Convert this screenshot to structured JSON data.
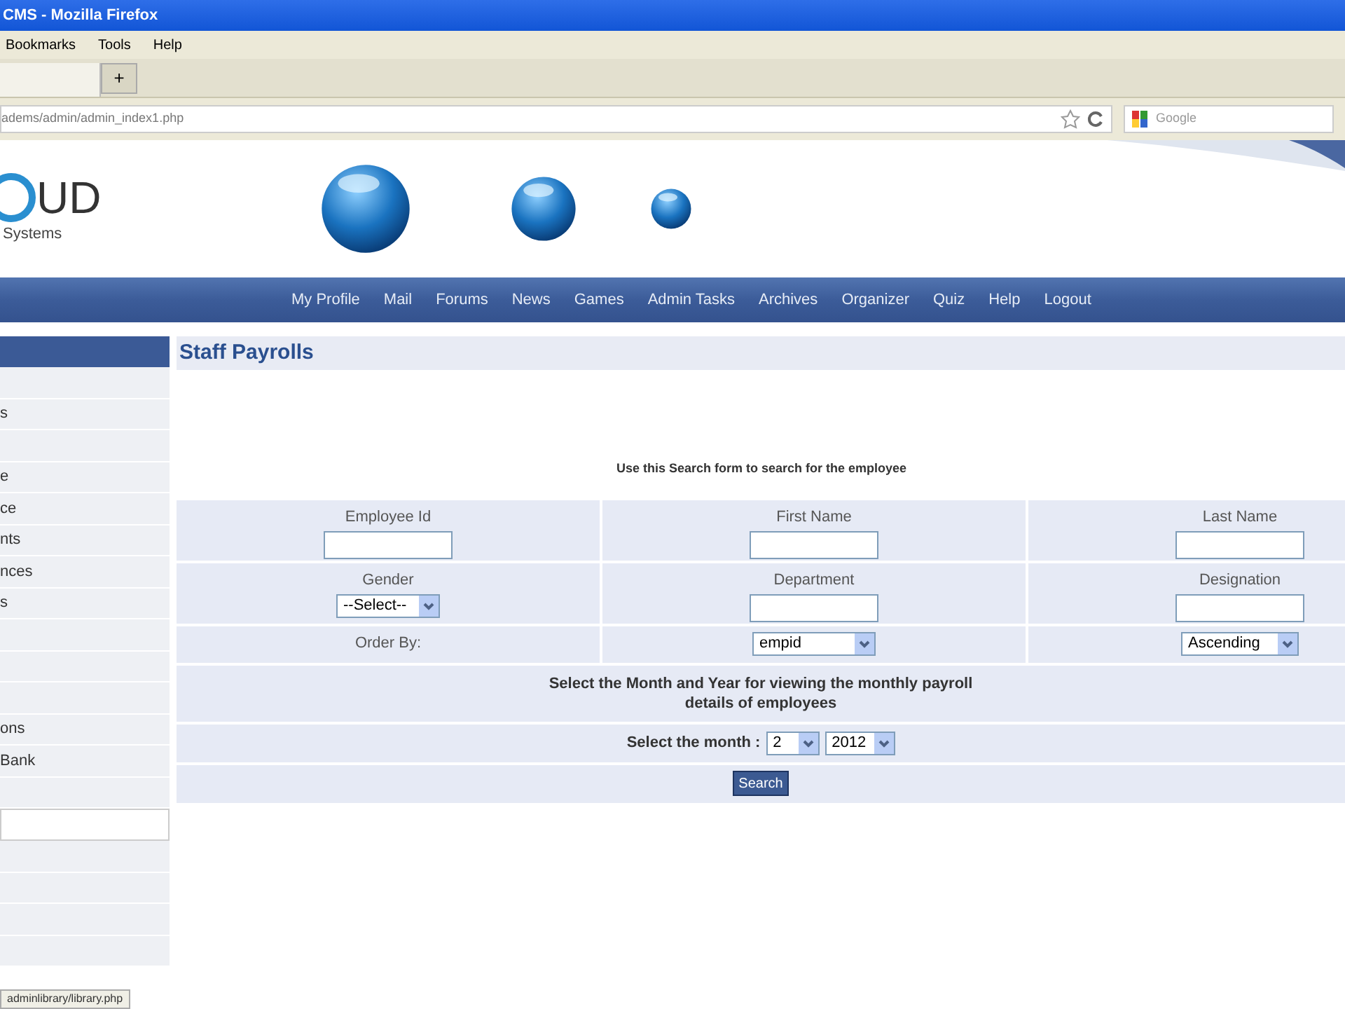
{
  "window": {
    "title": "CMS - Mozilla Firefox"
  },
  "menu": [
    "Bookmarks",
    "Tools",
    "Help"
  ],
  "new_tab": "+",
  "address": "adems/admin/admin_index1.php",
  "search_placeholder": "Google",
  "logo": {
    "mark": "UD",
    "tagline": "Systems"
  },
  "nav": [
    "My Profile",
    "Mail",
    "Forums",
    "News",
    "Games",
    "Admin Tasks",
    "Archives",
    "Organizer",
    "Quiz",
    "Help",
    "Logout"
  ],
  "sidebar": [
    {
      "kind": "row"
    },
    {
      "kind": "row",
      "label": "s"
    },
    {
      "kind": "row"
    },
    {
      "kind": "row",
      "label": "e"
    },
    {
      "kind": "row",
      "label": "ce"
    },
    {
      "kind": "row",
      "label": "nts"
    },
    {
      "kind": "row",
      "label": "nces"
    },
    {
      "kind": "row",
      "label": "s"
    },
    {
      "kind": "row"
    },
    {
      "kind": "row"
    },
    {
      "kind": "row"
    },
    {
      "kind": "row",
      "label": "ons"
    },
    {
      "kind": "row",
      "label": "Bank"
    },
    {
      "kind": "row"
    },
    {
      "kind": "field"
    },
    {
      "kind": "row"
    },
    {
      "kind": "row"
    },
    {
      "kind": "row"
    },
    {
      "kind": "row"
    }
  ],
  "page_title": "Staff Payrolls",
  "intro": "Use this Search form to search for the employee",
  "fields": [
    {
      "label": "Employee Id",
      "kind": "text"
    },
    {
      "label": "First Name",
      "kind": "text"
    },
    {
      "label": "Last Name",
      "kind": "text"
    },
    {
      "label": "Gender",
      "kind": "select",
      "value": "--Select--"
    },
    {
      "label": "Department",
      "kind": "text"
    },
    {
      "label": "Designation",
      "kind": "text"
    }
  ],
  "order_by": {
    "label": "Order By:",
    "field": "empid",
    "direction": "Ascending"
  },
  "month_note": "Select the Month and Year for viewing the monthly payroll details of employees",
  "month": {
    "label": "Select the month :",
    "month": "2",
    "year": "2012"
  },
  "search_button": "Search",
  "status_bar": "adminlibrary/library.php"
}
